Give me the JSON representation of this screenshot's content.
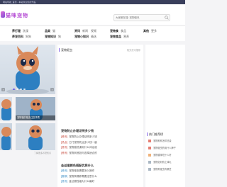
{
  "topbar": {
    "text": "网站导航_首页 - 本站欢迎您的光临"
  },
  "header": {
    "logo_text": "猫咪宠物",
    "search_placeholder": "大家都在搜: 宠物驱虫"
  },
  "nav": {
    "groups": [
      {
        "rows": [
          {
            "head": "",
            "items": []
          },
          {
            "head": "",
            "items": []
          }
        ]
      },
      {
        "rows": [
          {
            "head": "养打理",
            "items": [
              "洗澡"
            ]
          },
          {
            "head": "养宠百科",
            "items": [
              "狗狗"
            ]
          }
        ]
      },
      {
        "rows": [
          {
            "head": "品类",
            "items": [
              "猫"
            ]
          },
          {
            "head": "宠物知识",
            "items": [
              "狗"
            ]
          }
        ]
      },
      {
        "rows": [
          {
            "head": "资讯",
            "items": [
              "新闻",
              "视频"
            ]
          },
          {
            "head": "宠物小知识",
            "items": [
              "精选"
            ]
          }
        ]
      },
      {
        "rows": [
          {
            "head": "宠物食",
            "items": [
              "食品"
            ]
          },
          {
            "head": "宠物食品",
            "items": [
              "营养"
            ]
          }
        ]
      },
      {
        "rows": [
          {
            "head": "其他",
            "items": [
              "更多"
            ]
          },
          {
            "head": "",
            "items": []
          }
        ]
      }
    ]
  },
  "slider": {
    "caption": ""
  },
  "thumbs": [
    {
      "caption": "宠物猫的驱虫注意事项"
    },
    {
      "caption": ""
    },
    {
      "caption": ""
    },
    {
      "caption": ""
    }
  ],
  "more_small": "了解更多养宠知识",
  "content": {
    "section_title": "宠物驱虫",
    "section_more": "相关资讯推荐",
    "headline1": "宠物防止办理证明多少钱",
    "list1": [
      {
        "tag": "[资讯]",
        "text": "宠物防止办理证明多少钱"
      },
      {
        "tag": "[热点]",
        "text": "日门宠物托运多少钱一趟"
      },
      {
        "tag": "[资讯]",
        "text": "宠物猫洗澡用什么沐浴液"
      },
      {
        "tag": "[资讯]",
        "text": "宠物到底如何选择适合的"
      },
      {
        "tag": "[问答]",
        "text": "这样宠物驱虫需要多少"
      }
    ],
    "headline2": "金丝猴颜色搭配优质什么",
    "list2": [
      {
        "tag": "[资讯]",
        "text": "宠物驱虫需要怎么操作"
      },
      {
        "tag": "[推荐]",
        "text": "宠物狗喂养需要注意什么"
      },
      {
        "tag": "[资讯]",
        "text": "金丝猴性格为什么最好"
      },
      {
        "tag": "[资讯]",
        "text": "以上就是宠物的护理方法"
      }
    ]
  },
  "right": {
    "rank_title": "热门推荐榜",
    "items": [
      {
        "text": "宠物狗狗怎样洗澡",
        "color": "#e67e73"
      },
      {
        "text": "宠物驱虫药用什么牌子",
        "color": "#e67e73"
      },
      {
        "text": "宠物猫咪吃什么好",
        "color": "#f0b27a"
      },
      {
        "text": "宠物如何防止掉毛",
        "color": "#aab7c4"
      },
      {
        "text": "宠物狗驱虫有哪些",
        "color": "#aab7c4"
      }
    ]
  },
  "colors": {
    "accent": "#8a6de9",
    "topbar": "#3a3f5c"
  }
}
